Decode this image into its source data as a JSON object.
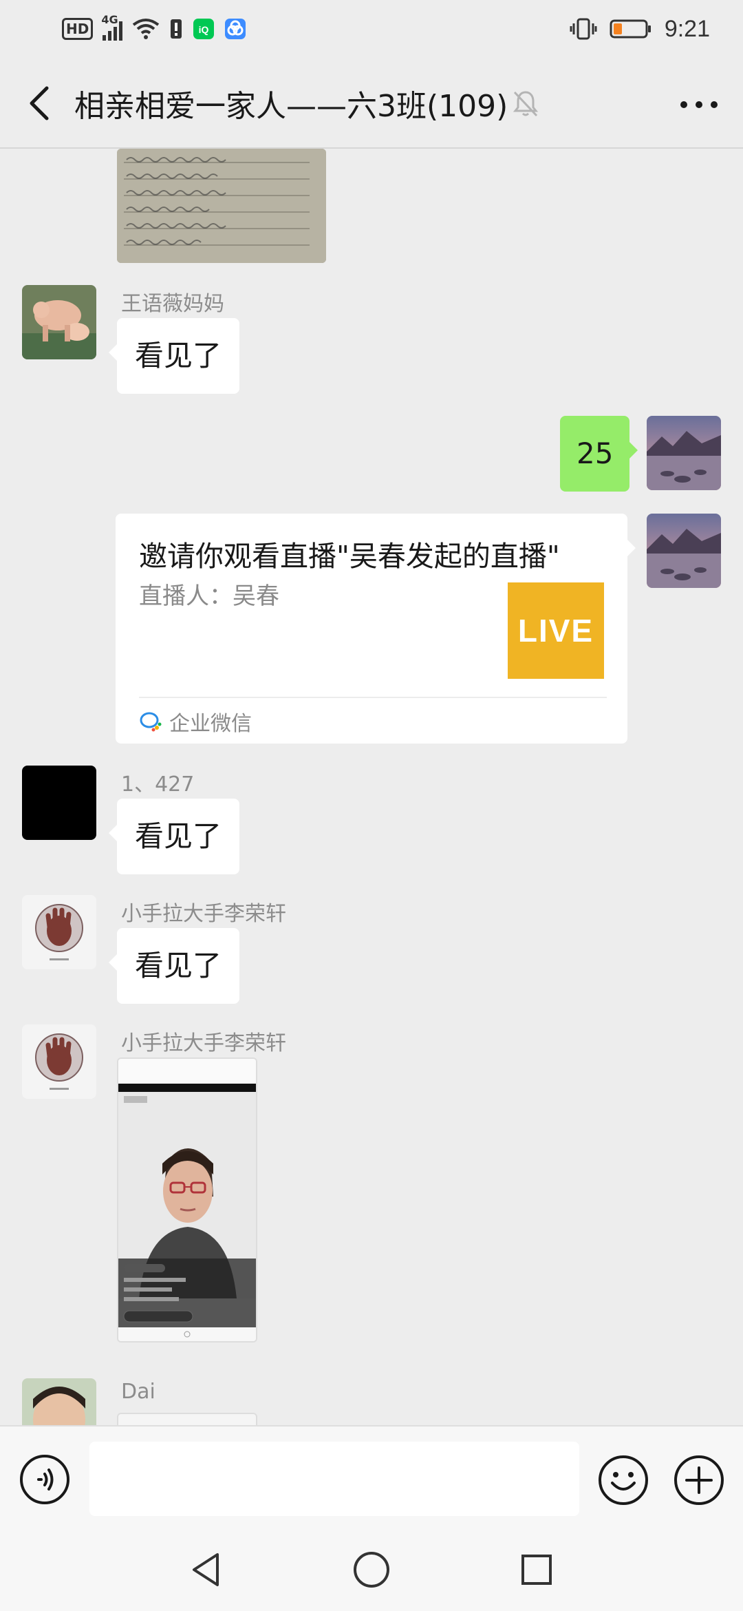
{
  "status_bar": {
    "network_label": "HD",
    "signal_label": "4G",
    "time": "9:21"
  },
  "header": {
    "title": "相亲相爱一家人——六3班(109)"
  },
  "messages": {
    "m1_nick": "王语薇妈妈",
    "m1_text": "看见了",
    "m2_text": "25",
    "card": {
      "title": "邀请你观看直播\"吴春发起的直播\"",
      "host": "直播人：吴春",
      "badge": "LIVE",
      "source": "企业微信"
    },
    "m4_nick": "1、427",
    "m4_text": "看见了",
    "m5_nick": "小手拉大手李荣轩",
    "m5_text": "看见了",
    "m6_nick": "小手拉大手李荣轩",
    "m7_nick": "Dai"
  },
  "colors": {
    "background": "#ededed",
    "self_bubble": "#95ec69",
    "other_bubble": "#ffffff",
    "live_badge": "#f0b424"
  }
}
